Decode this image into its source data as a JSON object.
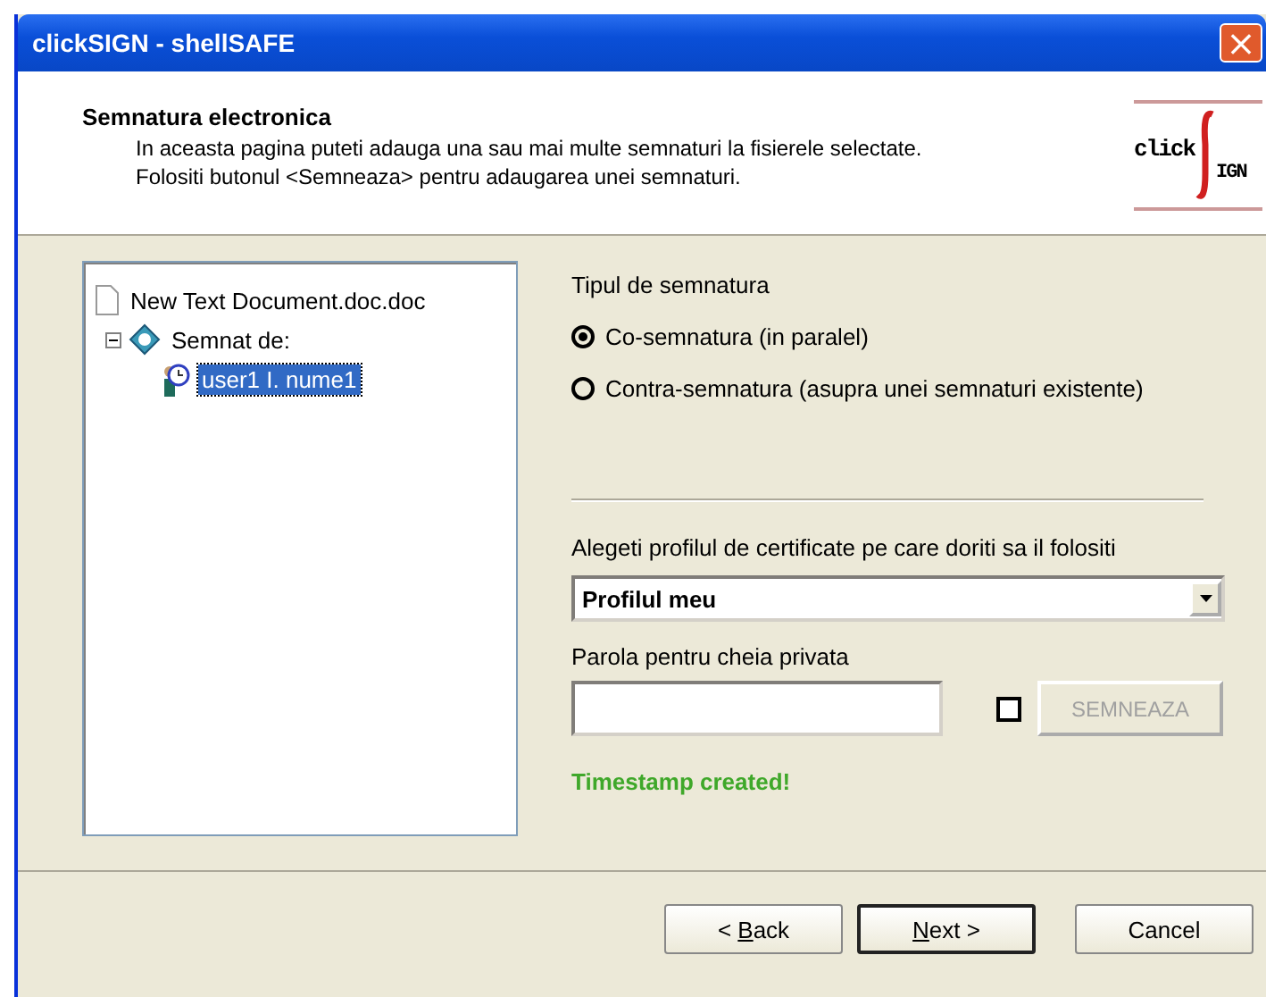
{
  "window": {
    "title": "clickSIGN - shellSAFE",
    "close": "×"
  },
  "header": {
    "title": "Semnatura electronica",
    "lines": [
      "In aceasta pagina puteti adauga una sau mai multe semnaturi la fisierele selectate.",
      "Folositi butonul <Semneaza> pentru adaugarea unei semnaturi."
    ],
    "logo": {
      "left": "click",
      "right": "IGN"
    }
  },
  "tree": [
    {
      "label": "New Text Document.doc.doc",
      "kind": "file",
      "selected": false,
      "children": [
        {
          "label": "Semnat de:",
          "kind": "signed",
          "expanded": true,
          "selected": false,
          "children": [
            {
              "label": "user1 I. nume1",
              "kind": "user",
              "selected": true
            }
          ]
        }
      ]
    }
  ],
  "signature_type": {
    "title": "Tipul de semnatura",
    "options": [
      {
        "label": "Co-semnatura (in paralel)",
        "selected": true
      },
      {
        "label": "Contra-semnatura (asupra unei semnaturi existente)",
        "selected": false
      }
    ]
  },
  "profile": {
    "label": "Alegeti profilul de certificate pe care doriti sa il folositi",
    "value": "Profilul meu"
  },
  "password": {
    "label": "Parola pentru cheia privata",
    "checked": false,
    "button": {
      "label": "SEMNEAZA",
      "disabled": true
    }
  },
  "status": "Timestamp created!",
  "buttons": [
    {
      "before": "< ",
      "key": "B",
      "after": "ack",
      "default": false
    },
    {
      "key": "N",
      "after": "ext >",
      "default": true
    },
    {
      "before": "Cancel",
      "default": false
    }
  ]
}
